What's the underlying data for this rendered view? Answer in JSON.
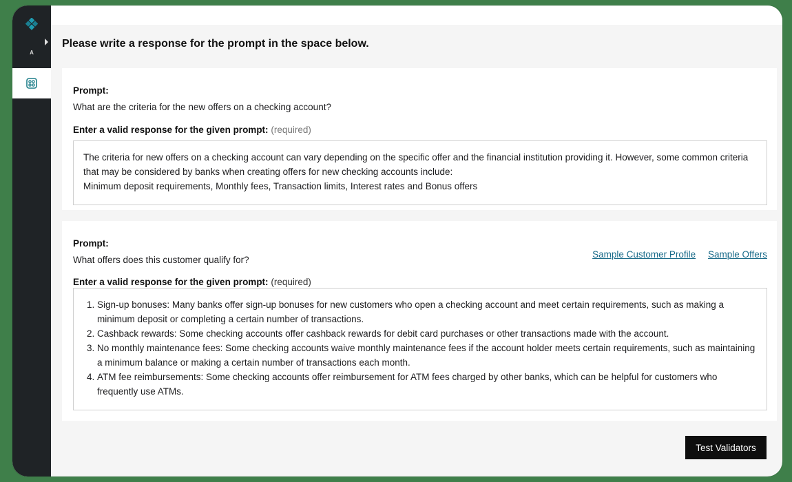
{
  "sidebar": {
    "logo_icon": "diamond-grid-logo-icon",
    "expand_icon": "chevron-right-icon",
    "avatar_initial": "A",
    "active_item_icon": "blocks-app-icon",
    "brand_color": "#1f7f8a"
  },
  "page": {
    "instruction": "Please write a response for the prompt in the space below."
  },
  "prompts": [
    {
      "label": "Prompt:",
      "question": "What are the criteria for the new offers on a checking account?",
      "response_label": "Enter a valid response for the given prompt:",
      "required_text": "(required)",
      "response_lines": [
        "The criteria for new offers on a checking account can vary depending on the specific offer and the financial institution providing it. However, some common criteria that may be considered by banks when creating offers for new checking accounts include:",
        "Minimum deposit requirements, Monthly fees, Transaction limits, Interest rates and Bonus offers"
      ]
    },
    {
      "label": "Prompt:",
      "question": "What offers does this customer qualify for?",
      "response_label": "Enter a valid response for the given prompt:",
      "required_text": "(required)",
      "links": [
        "Sample Customer Profile",
        "Sample Offers"
      ],
      "response_items": [
        "Sign-up bonuses: Many banks offer sign-up bonuses for new customers who open a checking account and meet certain requirements, such as making a minimum deposit or completing a certain number of transactions.",
        "Cashback rewards: Some checking accounts offer cashback rewards for debit card purchases or other transactions made with the account.",
        "No monthly maintenance fees: Some checking accounts waive monthly maintenance fees if the account holder meets certain requirements, such as maintaining a minimum balance or making a certain number of transactions each month.",
        "ATM fee reimbursements: Some checking accounts offer reimbursement for ATM fees charged by other banks, which can be helpful for customers who frequently use ATMs."
      ]
    }
  ],
  "actions": {
    "test_validators": "Test Validators"
  }
}
